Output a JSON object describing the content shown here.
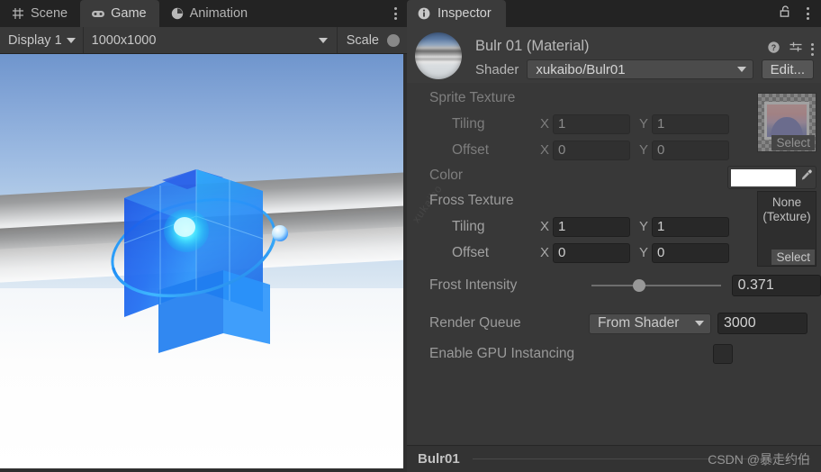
{
  "game_panel": {
    "tabs": [
      {
        "label": "Scene",
        "icon": "grid-icon",
        "active": false
      },
      {
        "label": "Game",
        "icon": "gamepad-icon",
        "active": true
      },
      {
        "label": "Animation",
        "icon": "clock-icon",
        "active": false
      }
    ],
    "overflow_icon": "kebab-menu-icon",
    "toolbar": {
      "display": "Display 1",
      "resolution": "1000x1000",
      "scale_label": "Scale"
    },
    "viewport": {
      "description": "Blue translucent rubik-style cube with glowing core and orbiting ring"
    }
  },
  "inspector": {
    "tab_label": "Inspector",
    "tab_icon": "info-icon",
    "lock_icon": "lock-open-icon",
    "overflow_icon": "kebab-menu-icon",
    "material": {
      "title": "Bulr 01 (Material)",
      "preview_icon": "material-sphere-preview",
      "help_icon": "help-icon",
      "preset_icon": "preset-icon",
      "menu_icon": "kebab-menu-icon",
      "shader_label": "Shader",
      "shader_value": "xukaibo/Bulr01",
      "edit_label": "Edit..."
    },
    "properties": {
      "sprite_texture": {
        "label": "Sprite Texture",
        "enabled": false,
        "tiling_label": "Tiling",
        "offset_label": "Offset",
        "x_label": "X",
        "y_label": "Y",
        "tiling_x": "1",
        "tiling_y": "1",
        "offset_x": "0",
        "offset_y": "0",
        "select_label": "Select",
        "thumbnail_icon": "texture-thumbnail"
      },
      "color": {
        "label": "Color",
        "value_hex": "#ffffff",
        "eyedropper_icon": "eyedropper-icon"
      },
      "fross_texture": {
        "label": "Fross Texture",
        "none_label": "None",
        "none_type": "(Texture)",
        "tiling_label": "Tiling",
        "offset_label": "Offset",
        "x_label": "X",
        "y_label": "Y",
        "tiling_x": "1",
        "tiling_y": "1",
        "offset_x": "0",
        "offset_y": "0",
        "select_label": "Select"
      },
      "frost_intensity": {
        "label": "Frost Intensity",
        "value": "0.371",
        "slider_percent": 37
      },
      "render_queue": {
        "label": "Render Queue",
        "mode": "From Shader",
        "value": "3000"
      },
      "gpu_instancing": {
        "label": "Enable GPU Instancing",
        "checked": false
      }
    },
    "status": {
      "name": "Bulr01",
      "watermark": "CSDN @暴走约伯"
    },
    "side_watermark": "xukaibo"
  }
}
